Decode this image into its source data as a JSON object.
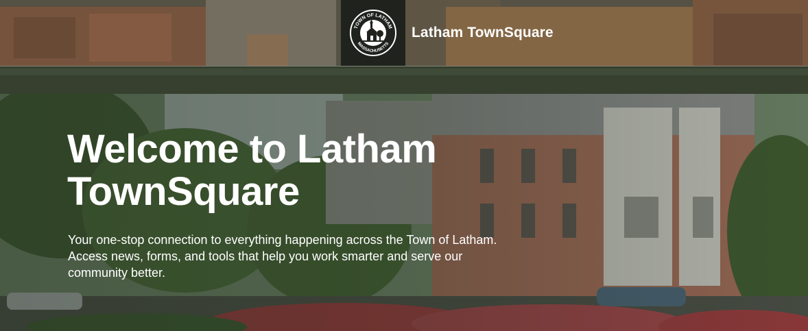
{
  "header": {
    "site_title": "Latham TownSquare",
    "seal": {
      "top_text": "TOWN OF LATHAM",
      "bottom_text": "MASSACHUSETTS"
    }
  },
  "hero": {
    "title_line1": "Welcome to Latham",
    "title_line2": "TownSquare",
    "subtitle": "Your one-stop connection to everything happening across the Town of Latham. Access news, forms, and tools that help you work smarter and serve our community better."
  },
  "colors": {
    "seal_background": "#1f221d",
    "text": "#ffffff"
  }
}
